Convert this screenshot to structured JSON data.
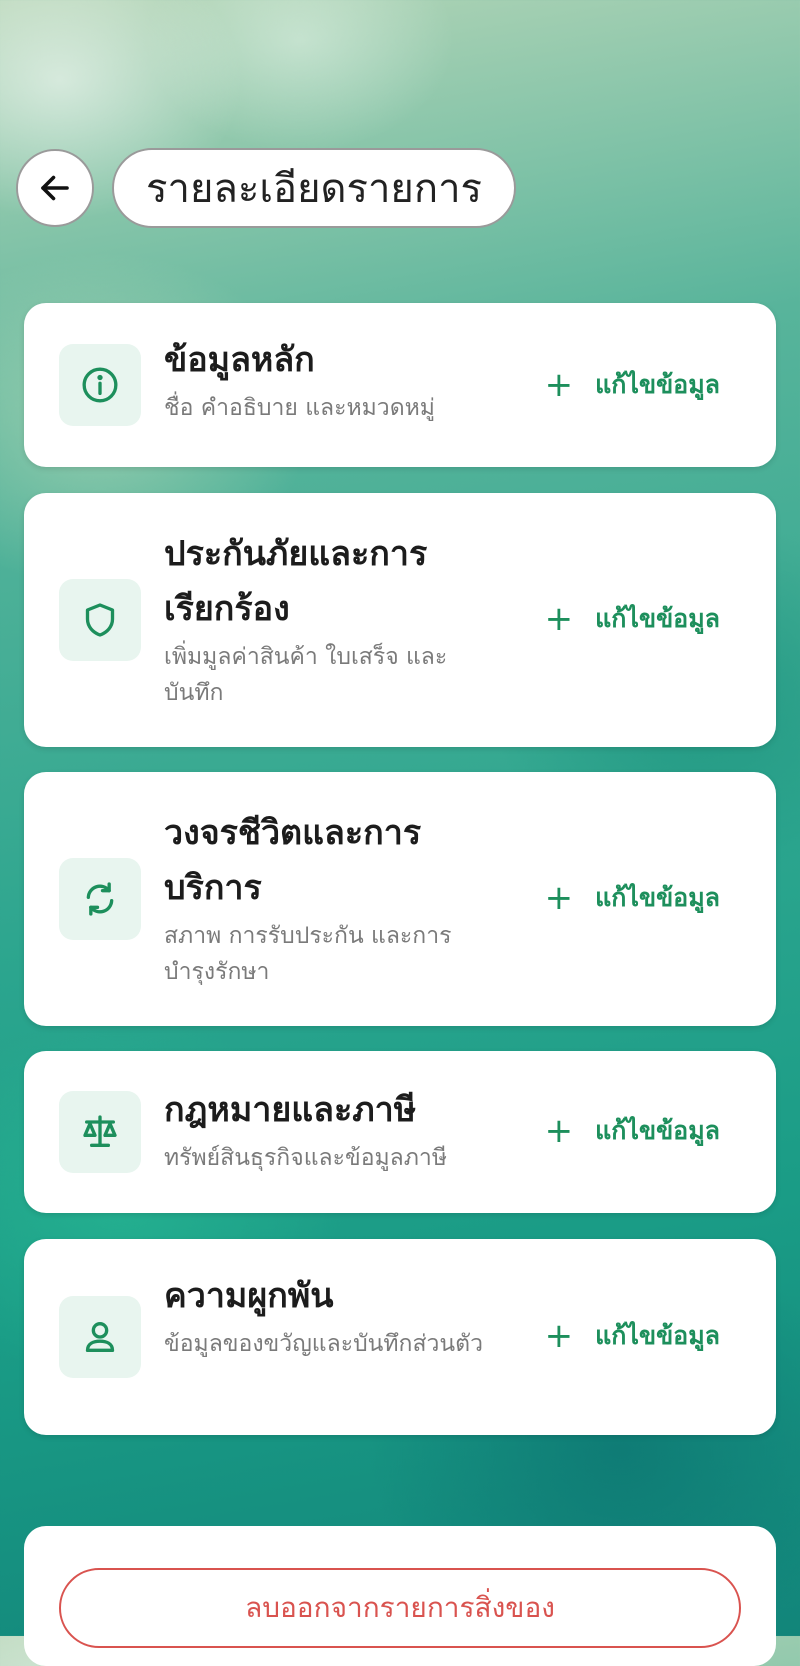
{
  "header": {
    "back_icon": "arrow-left-icon",
    "title": "รายละเอียดรายการ"
  },
  "sections": [
    {
      "icon": "info-icon",
      "title": "ข้อมูลหลัก",
      "subtitle": "ชื่อ คำอธิบาย และหมวดหมู่",
      "action_label": "แก้ไขข้อมูล"
    },
    {
      "icon": "shield-icon",
      "title": "ประกันภัยและการเรียกร้อง",
      "subtitle": "เพิ่มมูลค่าสินค้า ใบเสร็จ และบันทึก",
      "action_label": "แก้ไขข้อมูล"
    },
    {
      "icon": "refresh-icon",
      "title": "วงจรชีวิตและการบริการ",
      "subtitle": "สภาพ การรับประกัน และการบำรุงรักษา",
      "action_label": "แก้ไขข้อมูล"
    },
    {
      "icon": "scale-icon",
      "title": "กฎหมายและภาษี",
      "subtitle": "ทรัพย์สินธุรกิจและข้อมูลภาษี",
      "action_label": "แก้ไขข้อมูล"
    },
    {
      "icon": "user-icon",
      "title": "ความผูกพัน",
      "subtitle": "ข้อมูลของขวัญและบันทึกส่วนตัว",
      "action_label": "แก้ไขข้อมูล"
    }
  ],
  "footer": {
    "delete_label": "ลบออกจากรายการสิ่งของ"
  },
  "colors": {
    "accent": "#1d8f5c",
    "icon_bg": "#e8f5ef",
    "danger": "#d9534f"
  }
}
